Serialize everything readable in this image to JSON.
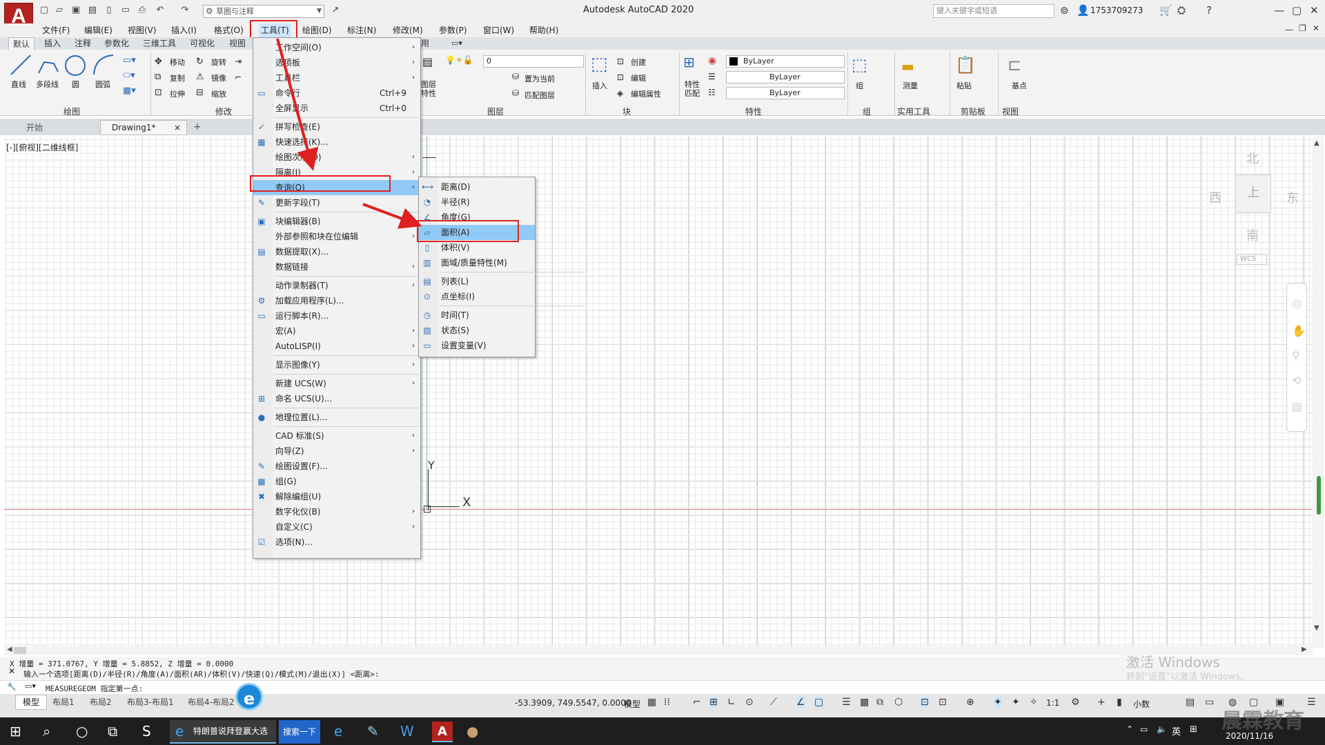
{
  "app": {
    "logo": "A",
    "title": "Autodesk AutoCAD 2020",
    "workspace": "草图与注释",
    "search_placeholder": "键入关键字或短语",
    "user": "1753709273"
  },
  "menubar": [
    "文件(F)",
    "编辑(E)",
    "视图(V)",
    "插入(I)",
    "格式(O)",
    "工具(T)",
    "绘图(D)",
    "标注(N)",
    "修改(M)",
    "参数(P)",
    "窗口(W)",
    "帮助(H)"
  ],
  "ribbon_tabs": [
    "默认",
    "插入",
    "注释",
    "参数化",
    "三维工具",
    "可视化",
    "视图",
    "用"
  ],
  "ribbon": {
    "draw_tools": [
      "直线",
      "多段线",
      "圆",
      "圆弧"
    ],
    "modify_tools": [
      "移动",
      "旋转",
      "复制",
      "镜像",
      "拉伸",
      "缩放"
    ],
    "draw_panel": "绘图",
    "modify_panel": "修改",
    "layer_value": "0",
    "layer_current": "置为当前",
    "layer_match": "匹配图层",
    "layer_panel": "图层",
    "layer_props": "图层特性",
    "insert": "插入",
    "block_create": "创建",
    "block_edit": "编辑",
    "block_attr": "编辑属性",
    "block_panel": "块",
    "match_props": "特性匹配",
    "bylayer1": "ByLayer",
    "bylayer2": "ByLayer",
    "bylayer3": "ByLayer",
    "props_panel": "特性",
    "group": "组",
    "group_panel": "组",
    "measure": "测量",
    "util_panel": "实用工具",
    "paste": "粘贴",
    "clip_panel": "剪贴板",
    "basepoint": "基点",
    "view_panel": "视图"
  },
  "doc_tabs": {
    "start": "开始",
    "drawing": "Drawing1*",
    "close": "×",
    "add": "+"
  },
  "viewport_label": "[-][俯视][二维线框]",
  "viewcube": {
    "north": "北",
    "south": "南",
    "east": "东",
    "west": "西",
    "face": "上",
    "wcs": "WCS"
  },
  "tools_menu": [
    {
      "label": "工作空间(O)",
      "arrow": true
    },
    {
      "label": "选项板",
      "arrow": true
    },
    {
      "label": "工具栏",
      "arrow": true
    },
    {
      "label": "命令行",
      "shortcut": "Ctrl+9",
      "icon": "▭"
    },
    {
      "label": "全屏显示",
      "shortcut": "Ctrl+0"
    },
    {
      "sep": true
    },
    {
      "label": "拼写检查(E)",
      "icon": "✓"
    },
    {
      "label": "快速选择(K)...",
      "icon": "▦"
    },
    {
      "label": "绘图次序(D)",
      "arrow": true
    },
    {
      "label": "隔离(I)",
      "arrow": true
    },
    {
      "label": "查询(Q)",
      "arrow": true,
      "highlight": true
    },
    {
      "label": "更新字段(T)",
      "icon": "✎"
    },
    {
      "sep": true
    },
    {
      "label": "块编辑器(B)",
      "icon": "▣"
    },
    {
      "label": "外部参照和块在位编辑",
      "arrow": true
    },
    {
      "label": "数据提取(X)...",
      "icon": "▤"
    },
    {
      "label": "数据链接",
      "arrow": true
    },
    {
      "sep": true
    },
    {
      "label": "动作录制器(T)",
      "arrow": true
    },
    {
      "label": "加载应用程序(L)...",
      "icon": "⚙"
    },
    {
      "label": "运行脚本(R)...",
      "icon": "▭"
    },
    {
      "label": "宏(A)",
      "arrow": true
    },
    {
      "label": "AutoLISP(I)",
      "arrow": true
    },
    {
      "sep": true
    },
    {
      "label": "显示图像(Y)",
      "arrow": true
    },
    {
      "sep": true
    },
    {
      "label": "新建 UCS(W)",
      "arrow": true
    },
    {
      "label": "命名 UCS(U)...",
      "icon": "⊞"
    },
    {
      "sep": true
    },
    {
      "label": "地理位置(L)...",
      "icon": "●"
    },
    {
      "sep": true
    },
    {
      "label": "CAD 标准(S)",
      "arrow": true
    },
    {
      "label": "向导(Z)",
      "arrow": true
    },
    {
      "label": "绘图设置(F)...",
      "icon": "✎"
    },
    {
      "label": "组(G)",
      "icon": "▦"
    },
    {
      "label": "解除编组(U)",
      "icon": "✖"
    },
    {
      "label": "数字化仪(B)",
      "arrow": true
    },
    {
      "label": "自定义(C)",
      "arrow": true
    },
    {
      "label": "选项(N)...",
      "icon": "☑"
    }
  ],
  "query_menu": [
    {
      "label": "距离(D)",
      "icon": "⟷"
    },
    {
      "label": "半径(R)",
      "icon": "◔"
    },
    {
      "label": "角度(G)",
      "icon": "∠"
    },
    {
      "label": "面积(A)",
      "icon": "▱",
      "highlight": true
    },
    {
      "label": "体积(V)",
      "icon": "▯"
    },
    {
      "label": "面域/质量特性(M)",
      "icon": "▥"
    },
    {
      "sep": true
    },
    {
      "label": "列表(L)",
      "icon": "▤"
    },
    {
      "label": "点坐标(I)",
      "icon": "⊙"
    },
    {
      "sep": true
    },
    {
      "label": "时间(T)",
      "icon": "◷"
    },
    {
      "label": "状态(S)",
      "icon": "▨"
    },
    {
      "label": "设置变量(V)",
      "icon": "▭"
    }
  ],
  "command": {
    "history": "X 增量 = 371.0767,   Y 增量 = 5.8852,    Z 增量 = 0.0000",
    "prompt": "输入一个选项[距离(D)/半径(R)/角度(A)/面积(AR)/体积(V)/快速(Q)/模式(M)/退出(X)] <距离>:",
    "current": "MEASUREGEOM 指定第一点:"
  },
  "watermark": {
    "line1": "激活 Windows",
    "line2": "转到\"设置\"以激活 Windows。"
  },
  "layout_tabs": [
    "模型",
    "布局1",
    "布局2",
    "布局3-布局1",
    "布局4-布局2"
  ],
  "status": {
    "coords": "-53.3909, 749.5547, 0.0000",
    "model": "模型",
    "scale": "1:1",
    "units": "小数"
  },
  "taskbar": {
    "ie_title": "特朗普说拜登赢大选",
    "search_btn": "搜索一下",
    "time": "2020/11/16",
    "ime": "英"
  },
  "brand": "晨霖教育"
}
